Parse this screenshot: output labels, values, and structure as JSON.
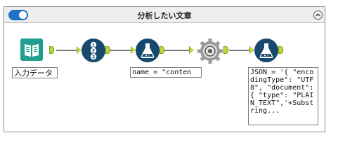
{
  "container": {
    "title": "分析したい文章",
    "enabled": true
  },
  "tools": [
    {
      "name": "input-data",
      "label": "入力データ"
    },
    {
      "name": "record-id",
      "icon": "numbered-list-icon"
    },
    {
      "name": "formula-1",
      "label": "name = \"content\"",
      "icon": "flask-icon"
    },
    {
      "name": "cross-tab",
      "icon": "gear-icon"
    },
    {
      "name": "formula-2",
      "label": "JSON = '{ \"encodingType\": \"UTF8\", \"document\": { \"type\": \"PLAIN_TEXT\",'+Substring...",
      "icon": "flask-icon"
    }
  ],
  "colors": {
    "toggle": "#1e73c9",
    "anchor": "#b5d842",
    "input_tool": "#1e9f8f",
    "formula_tool": "#17496e",
    "cross_tab_tool": "#9a9a9a"
  }
}
